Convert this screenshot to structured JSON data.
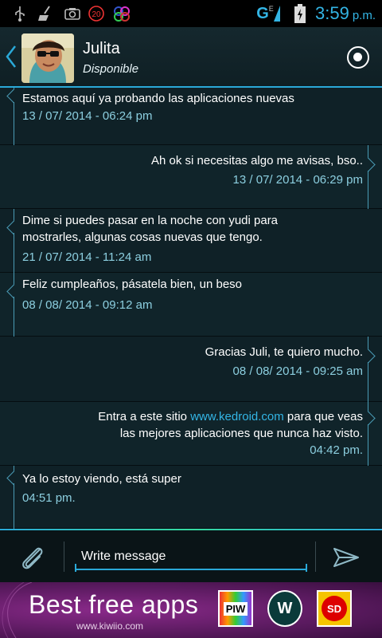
{
  "status_bar": {
    "time": "3:59",
    "ampm": "p.m.",
    "network": "G",
    "network_sub": "E",
    "badge": "20",
    "icons": [
      "usb-icon",
      "cleaner-icon",
      "screenshot-icon",
      "counter-badge-icon",
      "app-circles-icon",
      "signal-icon",
      "battery-charging-icon"
    ]
  },
  "header": {
    "contact_name": "Julita",
    "contact_status": "Disponible",
    "back_icon": "chevron-left-icon",
    "view_icon": "eye-icon"
  },
  "messages": [
    {
      "direction": "in",
      "text": "Estamos aquí ya probando las aplicaciones nuevas",
      "timestamp": "13 / 07/ 2014 - 06:24 pm"
    },
    {
      "direction": "out",
      "text": "Ah ok si necesitas algo me avisas, bso..",
      "timestamp": "13 / 07/ 2014 - 06:29 pm"
    },
    {
      "direction": "in",
      "text_line1": "Dime si puedes pasar en la noche con yudi para",
      "text_line2": "mostrarles, algunas cosas nuevas que tengo.",
      "timestamp": "21 / 07/ 2014 - 11:24 am"
    },
    {
      "direction": "in",
      "text": "Feliz cumpleaños, pásatela bien, un beso",
      "timestamp": "08 / 08/ 2014 - 09:12 am"
    },
    {
      "direction": "out",
      "text": "Gracias Juli, te quiero mucho.",
      "timestamp": "08 / 08/ 2014 - 09:25 am"
    },
    {
      "direction": "out",
      "text_before_link": "Entra a este sitio ",
      "link": "www.kedroid.com",
      "text_after_link": " para que veas",
      "text_line2": "las mejores aplicaciones que nunca haz visto.",
      "timestamp": "04:42 pm."
    },
    {
      "direction": "in",
      "text": "Ya lo estoy viendo, está super",
      "timestamp": "04:51 pm."
    }
  ],
  "composer": {
    "placeholder": "Write message",
    "attach_icon": "paperclip-icon",
    "send_icon": "send-icon"
  },
  "ad": {
    "title": "Best free apps",
    "subtitle": "www.kiwiio.com",
    "apps": [
      "PIW",
      "W",
      "SD"
    ]
  },
  "colors": {
    "accent": "#2aa9d8",
    "timestamp": "#8ccfe0",
    "link": "#33b5e5",
    "background": "#0f2127"
  }
}
